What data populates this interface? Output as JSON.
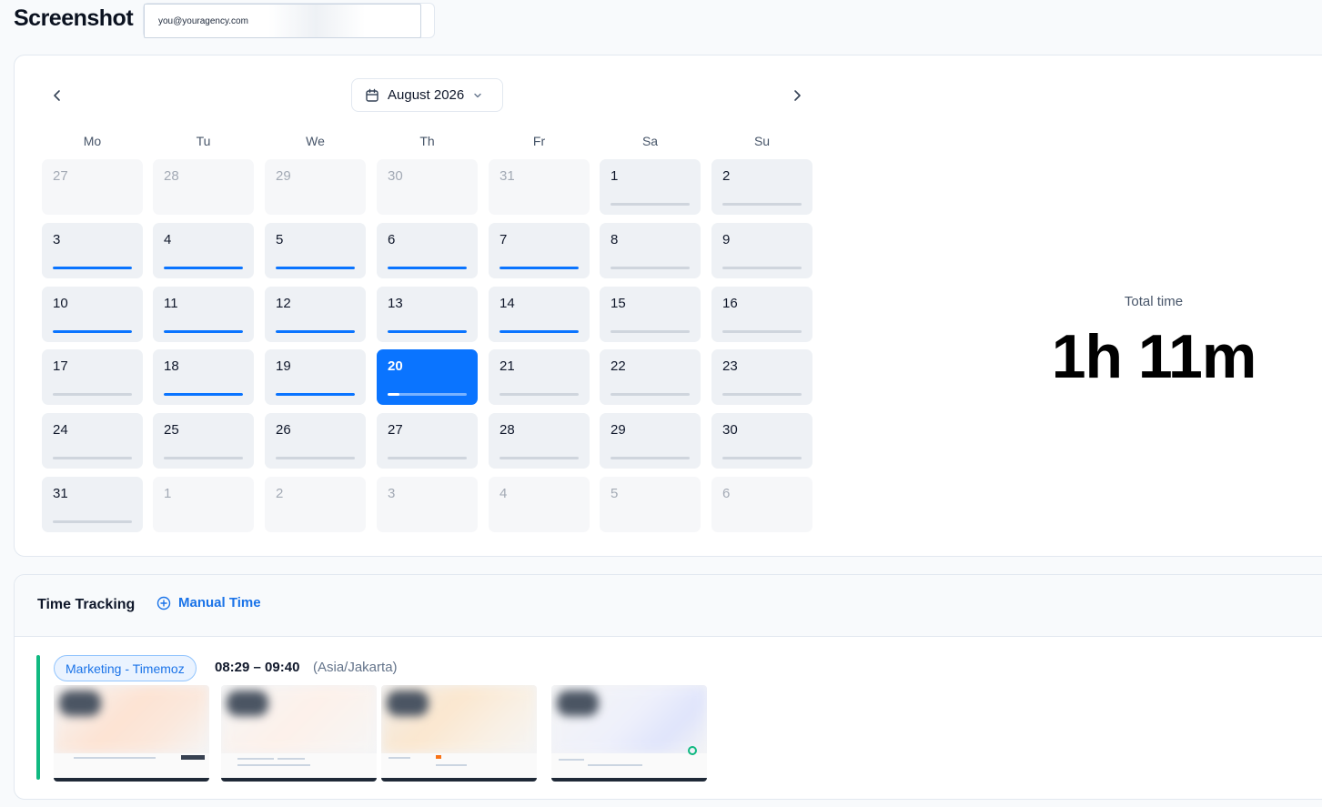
{
  "app": {
    "title": "Screenshot"
  },
  "user": {
    "email": "you@youragency.com"
  },
  "calendar": {
    "month_label": "August 2026",
    "weekdays": [
      "Mo",
      "Tu",
      "We",
      "Th",
      "Fr",
      "Sa",
      "Su"
    ],
    "selected_day": "20",
    "days": [
      {
        "n": "27",
        "out": true,
        "p": 0
      },
      {
        "n": "28",
        "out": true,
        "p": 0
      },
      {
        "n": "29",
        "out": true,
        "p": 0
      },
      {
        "n": "30",
        "out": true,
        "p": 0
      },
      {
        "n": "31",
        "out": true,
        "p": 0
      },
      {
        "n": "1",
        "out": false,
        "p": 0
      },
      {
        "n": "2",
        "out": false,
        "p": 0
      },
      {
        "n": "3",
        "out": false,
        "p": 1
      },
      {
        "n": "4",
        "out": false,
        "p": 1
      },
      {
        "n": "5",
        "out": false,
        "p": 1
      },
      {
        "n": "6",
        "out": false,
        "p": 1
      },
      {
        "n": "7",
        "out": false,
        "p": 1
      },
      {
        "n": "8",
        "out": false,
        "p": 0
      },
      {
        "n": "9",
        "out": false,
        "p": 0
      },
      {
        "n": "10",
        "out": false,
        "p": 1
      },
      {
        "n": "11",
        "out": false,
        "p": 1
      },
      {
        "n": "12",
        "out": false,
        "p": 1
      },
      {
        "n": "13",
        "out": false,
        "p": 1
      },
      {
        "n": "14",
        "out": false,
        "p": 1
      },
      {
        "n": "15",
        "out": false,
        "p": 0
      },
      {
        "n": "16",
        "out": false,
        "p": 0
      },
      {
        "n": "17",
        "out": false,
        "p": 0
      },
      {
        "n": "18",
        "out": false,
        "p": 1
      },
      {
        "n": "19",
        "out": false,
        "p": 1
      },
      {
        "n": "20",
        "out": false,
        "p": 0.15
      },
      {
        "n": "21",
        "out": false,
        "p": 0
      },
      {
        "n": "22",
        "out": false,
        "p": 0
      },
      {
        "n": "23",
        "out": false,
        "p": 0
      },
      {
        "n": "24",
        "out": false,
        "p": 0
      },
      {
        "n": "25",
        "out": false,
        "p": 0
      },
      {
        "n": "26",
        "out": false,
        "p": 0
      },
      {
        "n": "27",
        "out": false,
        "p": 0
      },
      {
        "n": "28",
        "out": false,
        "p": 0
      },
      {
        "n": "29",
        "out": false,
        "p": 0
      },
      {
        "n": "30",
        "out": false,
        "p": 0
      },
      {
        "n": "31",
        "out": false,
        "p": 0
      },
      {
        "n": "1",
        "out": true,
        "p": 0
      },
      {
        "n": "2",
        "out": true,
        "p": 0
      },
      {
        "n": "3",
        "out": true,
        "p": 0
      },
      {
        "n": "4",
        "out": true,
        "p": 0
      },
      {
        "n": "5",
        "out": true,
        "p": 0
      },
      {
        "n": "6",
        "out": true,
        "p": 0
      }
    ]
  },
  "summary": {
    "total_label": "Total time",
    "total_value": "1h 11m"
  },
  "time_tracking": {
    "title": "Time Tracking",
    "manual_time_label": "Manual Time",
    "sessions": [
      {
        "project": "Marketing - Timemoz",
        "time_range": "08:29 – 09:40",
        "timezone": "(Asia/Jakarta)",
        "screenshot_count": 4
      }
    ]
  },
  "colors": {
    "accent": "#0a74ff",
    "link": "#1a73e8",
    "session_marker": "#10b981",
    "tile_bg": "#eef1f5"
  },
  "icons": {
    "prev": "chevron-left-icon",
    "next": "chevron-right-icon",
    "calendar": "calendar-icon",
    "dropdown": "chevron-down-icon",
    "add": "plus-circle-icon"
  }
}
